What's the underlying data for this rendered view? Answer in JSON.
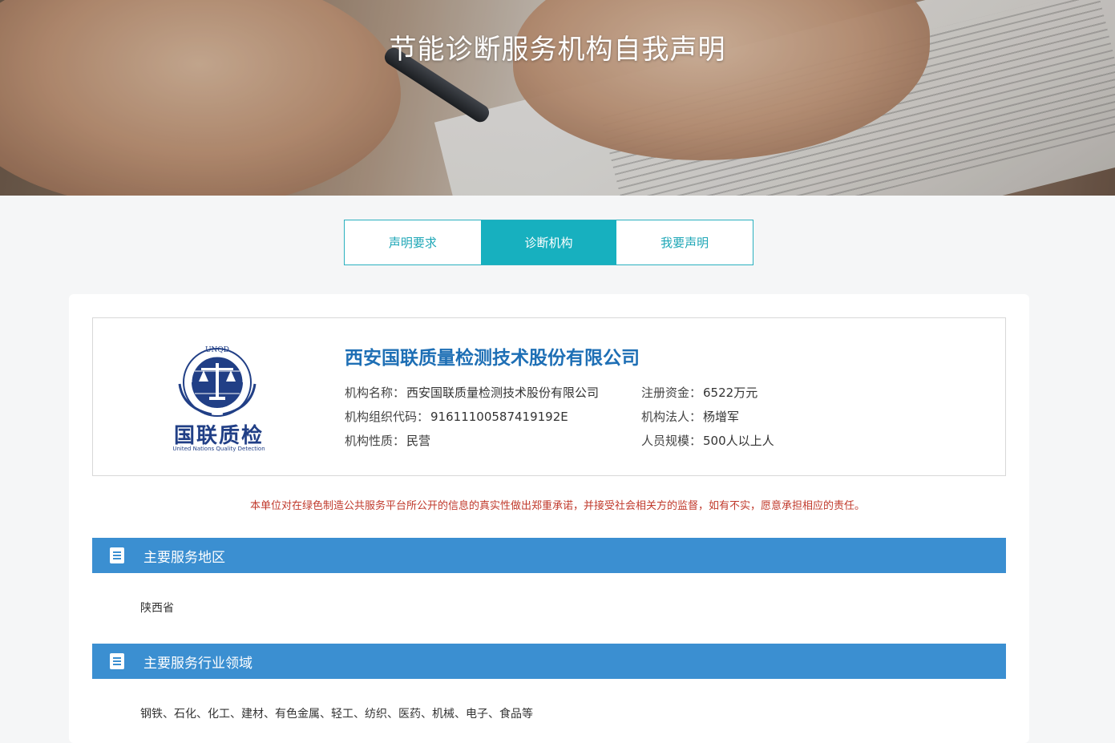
{
  "hero": {
    "title": "节能诊断服务机构自我声明"
  },
  "tabs": [
    {
      "label": "声明要求",
      "active": false
    },
    {
      "label": "诊断机构",
      "active": true
    },
    {
      "label": "我要声明",
      "active": false
    }
  ],
  "company": {
    "logo_text": "国联质检",
    "logo_subtext": "United Nations Quality Detection",
    "logo_ring_text": "UNQD",
    "title": "西安国联质量检测技术股份有限公司",
    "fields": {
      "name": {
        "label": "机构名称：",
        "value": "西安国联质量检测技术股份有限公司"
      },
      "code": {
        "label": "机构组织代码：",
        "value": "91611100587419192E"
      },
      "nature": {
        "label": "机构性质：",
        "value": "民营"
      },
      "capital": {
        "label": "注册资金：",
        "value": "6522万元"
      },
      "legal": {
        "label": "机构法人：",
        "value": "杨增军"
      },
      "scale": {
        "label": "人员规模：",
        "value": "500人以上人"
      }
    }
  },
  "notice": "本单位对在绿色制造公共服务平台所公开的信息的真实性做出郑重承诺，并接受社会相关方的监督，如有不实，愿意承担相应的责任。",
  "sections": [
    {
      "title": "主要服务地区",
      "content": "陕西省",
      "icon": "document-icon"
    },
    {
      "title": "主要服务行业领域",
      "content": "钢铁、石化、化工、建材、有色金属、轻工、纺织、医药、机械、电子、食品等",
      "icon": "document-icon"
    }
  ],
  "colors": {
    "tab_accent": "#17b0bf",
    "section_bar": "#3b8fd1",
    "company_title": "#1e6fb5",
    "notice": "#c0392b",
    "logo_blue": "#213f86"
  }
}
